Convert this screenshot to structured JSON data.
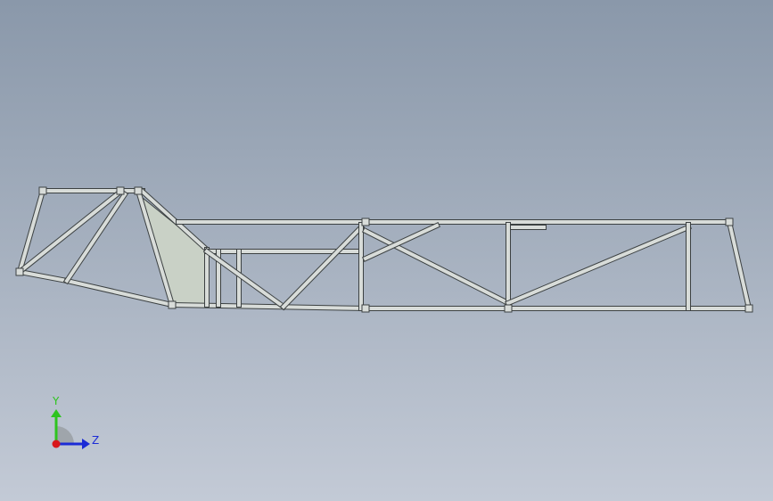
{
  "viewport": {
    "background_top": "#8a98aa",
    "background_bottom": "#c3cad6",
    "frame_color": "#d8dcd9",
    "frame_outline": "#3c4142",
    "panel_color": "#c9d1c6"
  },
  "triad": {
    "y_label": "Y",
    "z_label": "Z",
    "y_color": "#2ec41f",
    "z_color": "#1b2bd6",
    "x_color": "#d8161b",
    "plane_color": "#9aa0a4",
    "icon": "view-orientation-triad-icon"
  }
}
